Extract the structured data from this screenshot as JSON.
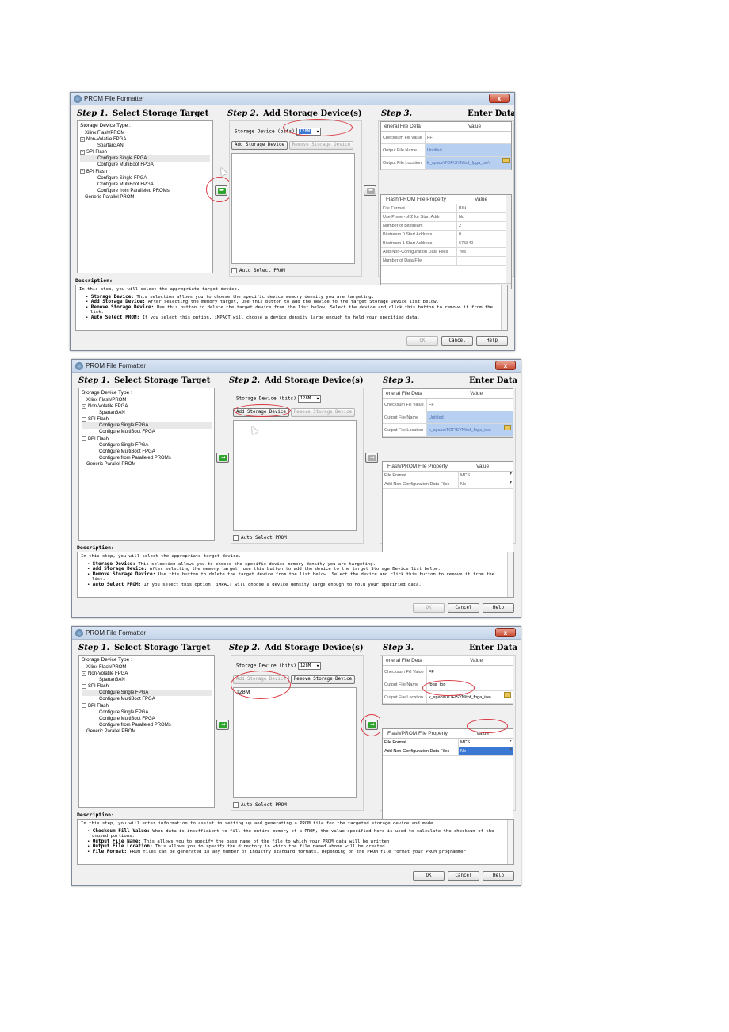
{
  "window_title": "PROM File Formatter",
  "close_label": "x",
  "steps": {
    "step1_num": "Step 1.",
    "step1_title": "Select Storage Target",
    "step2_num": "Step 2.",
    "step2_title": "Add Storage Device(s)",
    "step3_num": "Step 3.",
    "step3_title": "Enter Data"
  },
  "tree": {
    "header": "Storage Device Type :",
    "items": [
      "Xilinx Flash/PROM",
      "Non-Volatile FPGA",
      "Spartan3AN",
      "SPI Flash",
      "Configure Single FPGA",
      "Configure MultiBoot FPGA",
      "BPI Flash",
      "Configure Single FPGA",
      "Configure MultiBoot FPGA",
      "Configure from Paralleled PROMs",
      "Generic Parallel PROM"
    ]
  },
  "storage": {
    "label": "Storage Device (bits)",
    "value": "128M",
    "add_button": "Add Storage Device",
    "remove_button": "Remove Storage Device",
    "auto_select": "Auto Select PROM",
    "list_item": "128M"
  },
  "general_grid": {
    "col1": "eneral File Deta",
    "col2": "Value",
    "checksum_label": "Checksum Fill Value",
    "checksum_value": "FF",
    "output_name_label": "Output File Name",
    "output_name_untitled": "Untitled",
    "output_name_value": "fpga_top",
    "location_label": "Output File Location",
    "location_value": "k_space\\TOF\\SYN\\tof_fpga_ise\\"
  },
  "flash_grid": {
    "col1": "Flash/PROM File Property",
    "col2": "Value",
    "w1_rows": [
      {
        "k": "File Format",
        "v": "BIN"
      },
      {
        "k": "Use Power-of-2 for Start Addr",
        "v": "No"
      },
      {
        "k": "Number of Bitstream",
        "v": "2"
      },
      {
        "k": "Bitstream 0 Start Address",
        "v": "0"
      },
      {
        "k": "Bitstream 1 Start Address",
        "v": "675840"
      },
      {
        "k": "Add Non-Configuration Data Files",
        "v": "Yes"
      },
      {
        "k": "Number of Data File",
        "v": ""
      }
    ],
    "file_format_label": "File Format",
    "file_format_value": "MCS",
    "nonconfig_label": "Add Non-Configuration Data Files",
    "nonconfig_value": "No"
  },
  "description": {
    "label": "Description:",
    "intro_step2": "In this step, you will select the appropriate target device.",
    "b1_title": "Storage Device:",
    "b1_text": "This selection allows you to choose the specific device memory density you are targeting.",
    "b2_title": "Add Storage Device:",
    "b2_text": "After selecting the memory target, use this button to add the device to the target Storage Device list below.",
    "b3_title": "Remove Storage Device:",
    "b3_text": "Use this button to delete the target device from the list below. Select the device and click this button to remove it from the list.",
    "b4_title": "Auto Select PROM:",
    "b4_text": "If you select this option, iMPACT will choose a device density large enough to hold your specified data.",
    "intro_step3": "In this step, you will enter information to assist in setting up and generating a PROM file for the targeted storage device and mode.",
    "c1_title": "Checksum Fill Value:",
    "c1_text": "When data is insufficient to fill the entire memory of a PROM, the value specified here is used to calculate the checksum of the unused portions.",
    "c2_title": "Output File Name:",
    "c2_text": "This allows you to specify the base name of the file to which your PROM data will be written",
    "c3_title": "Output File Location:",
    "c3_text": "This allows you to specify the directory in which the file named above will be created",
    "c4_title": "File Format:",
    "c4_text": "PROM files can be generated in any number of industry standard formats. Depending on the PROM file format your PROM programmer"
  },
  "footer": {
    "ok": "OK",
    "cancel": "Cancel",
    "help": "Help"
  }
}
